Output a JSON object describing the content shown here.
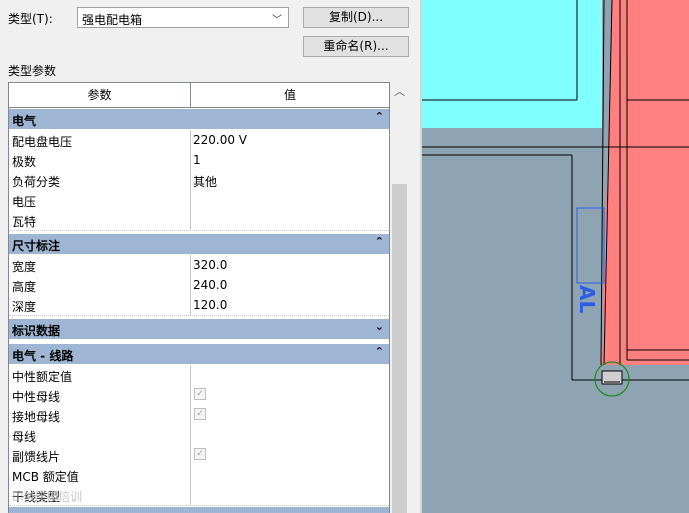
{
  "type_label": "类型(T):",
  "type_value": "强电配电箱",
  "buttons": {
    "duplicate": "复制(D)...",
    "rename": "重命名(R)..."
  },
  "section_title": "类型参数",
  "grid": {
    "header": {
      "param": "参数",
      "value": "值"
    },
    "groups": [
      {
        "title": "电气",
        "collapse_icon": "⌃",
        "rows": [
          {
            "name": "配电盘电压",
            "value": "220.00 V"
          },
          {
            "name": "极数",
            "value": "1"
          },
          {
            "name": "负荷分类",
            "value": "其他"
          },
          {
            "name": "电压",
            "value": ""
          },
          {
            "name": "瓦特",
            "value": ""
          }
        ]
      },
      {
        "title": "尺寸标注",
        "collapse_icon": "⌃",
        "rows": [
          {
            "name": "宽度",
            "value": "320.0"
          },
          {
            "name": "高度",
            "value": "240.0"
          },
          {
            "name": "深度",
            "value": "120.0"
          }
        ]
      },
      {
        "title": "标识数据",
        "expand_icon": "⌄"
      },
      {
        "title": "电气 - 线路",
        "collapse_icon": "⌃",
        "rows": [
          {
            "name": "中性额定值",
            "value": ""
          },
          {
            "name": "中性母线",
            "value": "",
            "checkbox": true
          },
          {
            "name": "接地母线",
            "value": "",
            "checkbox": true
          },
          {
            "name": "母线",
            "value": ""
          },
          {
            "name": "副馈线片",
            "value": "",
            "checkbox": true
          },
          {
            "name": "MCB 额定值",
            "value": ""
          },
          {
            "name": "干线类型",
            "value": ""
          }
        ]
      }
    ]
  },
  "watermark": "BIM建模培训",
  "view": {
    "colors": {
      "cyan": "#80ffff",
      "red": "#ff8080",
      "gray": "#8ea4b3",
      "blue": "#2b5ee8",
      "green": "#1a8c1a"
    },
    "annotation": "AL"
  }
}
